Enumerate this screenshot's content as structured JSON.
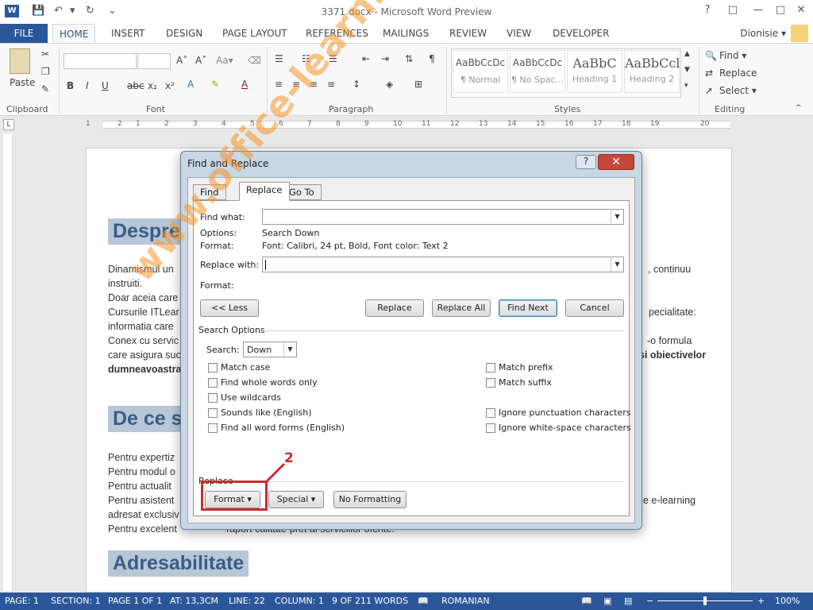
{
  "window": {
    "title": "3371.docx - Microsoft Word Preview",
    "app_icon": "W"
  },
  "ribbon_tabs": [
    "FILE",
    "HOME",
    "INSERT",
    "DESIGN",
    "PAGE LAYOUT",
    "REFERENCES",
    "MAILINGS",
    "REVIEW",
    "VIEW",
    "DEVELOPER"
  ],
  "user": {
    "name": "Dionisie ▾"
  },
  "ribbon": {
    "clipboard": {
      "paste": "Paste",
      "label": "Clipboard"
    },
    "font": {
      "label": "Font",
      "grow": "A˄",
      "shrink": "A˅",
      "case": "Aa▾",
      "bold": "B",
      "italic": "I",
      "underline": "U",
      "strike": "abc",
      "sub": "x₂",
      "sup": "x²"
    },
    "paragraph": {
      "label": "Paragraph",
      "pilcrow": "¶"
    },
    "styles": {
      "label": "Styles",
      "items": [
        {
          "sample": "AaBbCcDc",
          "name": "¶ Normal"
        },
        {
          "sample": "AaBbCcDc",
          "name": "¶ No Spac..."
        },
        {
          "sample": "AaBbC",
          "name": "Heading 1"
        },
        {
          "sample": "AaBbCcl",
          "name": "Heading 2"
        }
      ]
    },
    "editing": {
      "label": "Editing",
      "find": "Find ▾",
      "replace": "Replace",
      "select": "Select ▾"
    }
  },
  "ruler": {
    "numbers": [
      "1",
      "2",
      "1",
      "2",
      "3",
      "4",
      "5",
      "6",
      "7",
      "8",
      "9",
      "10",
      "11",
      "12",
      "13",
      "14",
      "15",
      "16",
      "17",
      "18",
      "19",
      "20"
    ]
  },
  "document": {
    "heading1": "Despre",
    "heading2": "De ce s",
    "heading3": "Adresabilitate",
    "lines1": [
      "Dinamismul un",
      "instruiti.",
      "Doar aceia care",
      "Cursurile ITLear",
      "informatia care",
      "Conex cu servic",
      "care asigura suc"
    ],
    "line_bold": "dumneavoastra",
    "right1": ", continuu",
    "right2": "pecialitate:",
    "right3": "-o formula",
    "right4": "si obiectivelor",
    "lines2": [
      "Pentru expertiz",
      "Pentru modul o",
      "Pentru actualit",
      "Pentru asistent",
      "adresat exclusiv",
      "Pentru excelent"
    ],
    "right5": "de e-learning",
    "tail": "raport calitate-pret al serviciilor oferite."
  },
  "watermark": "www.office-learning.ro",
  "dialog": {
    "title": "Find and Replace",
    "help": "?",
    "close": "✕",
    "tabs": [
      "Find",
      "Replace",
      "Go To"
    ],
    "find_label": "Find what:",
    "find_value": "",
    "options_label": "Options:",
    "options_value": "Search Down",
    "format_label": "Format:",
    "format_value": "Font: Calibri, 24 pt, Bold, Font color: Text 2",
    "replace_label": "Replace with:",
    "replace_value": "",
    "format2_label": "Format:",
    "buttons": {
      "less": "<< Less",
      "replace": "Replace",
      "replace_all": "Replace All",
      "find_next": "Find Next",
      "cancel": "Cancel"
    },
    "search_options_label": "Search Options",
    "search_label": "Search:",
    "search_value": "Down",
    "checkboxes_left": [
      "Match case",
      "Find whole words only",
      "Use wildcards",
      "Sounds like (English)",
      "Find all word forms (English)"
    ],
    "checkboxes_right_top": [
      "Match prefix",
      "Match suffix"
    ],
    "checkboxes_right_bottom": [
      "Ignore punctuation characters",
      "Ignore white-space characters"
    ],
    "replace_section_label": "Replace",
    "bottom_buttons": {
      "format": "Format ▾",
      "special": "Special ▾",
      "no_formatting": "No Formatting"
    },
    "callout": "2"
  },
  "statusbar": {
    "page": "PAGE: 1",
    "section": "SECTION: 1",
    "pages": "PAGE 1 OF 1",
    "at": "AT: 13,3CM",
    "line": "LINE: 22",
    "column": "COLUMN: 1",
    "words": "9 OF 211 WORDS",
    "language": "ROMANIAN",
    "zoom": "100%"
  },
  "colors": {
    "accent": "#2b579a",
    "heading_bg": "#b8c7d7",
    "heading_text": "#3a5d86",
    "callout": "#d12a2a"
  }
}
